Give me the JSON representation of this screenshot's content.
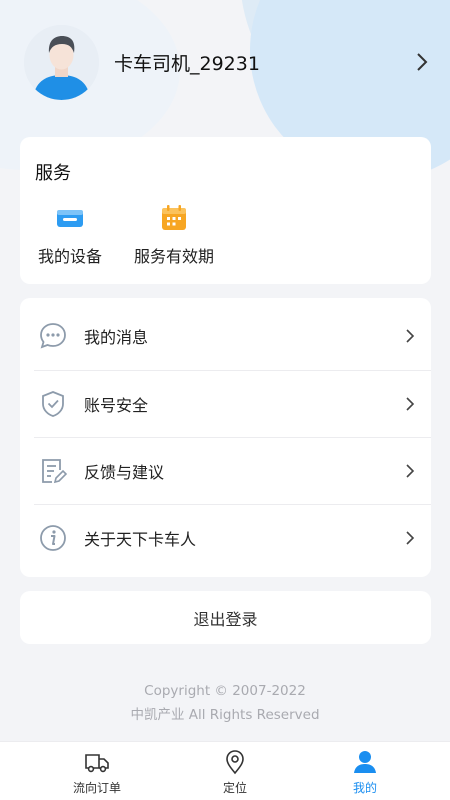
{
  "profile": {
    "name": "卡车司机_29231"
  },
  "services": {
    "title": "服务",
    "items": [
      {
        "label": "我的设备",
        "icon": "device-icon"
      },
      {
        "label": "服务有效期",
        "icon": "calendar-icon"
      }
    ]
  },
  "menu": {
    "items": [
      {
        "label": "我的消息",
        "icon": "message-icon"
      },
      {
        "label": "账号安全",
        "icon": "shield-check-icon"
      },
      {
        "label": "反馈与建议",
        "icon": "feedback-icon"
      },
      {
        "label": "关于天下卡车人",
        "icon": "info-icon"
      }
    ]
  },
  "logout": {
    "label": "退出登录"
  },
  "footer": {
    "copyright_line1": "Copyright © 2007-2022",
    "copyright_line2": "中凯产业 All Rights Reserved"
  },
  "tabbar": {
    "tabs": [
      {
        "label": "流向订单",
        "icon": "truck-icon",
        "active": false
      },
      {
        "label": "定位",
        "icon": "location-pin-icon",
        "active": false
      },
      {
        "label": "我的",
        "icon": "person-icon",
        "active": true
      }
    ]
  },
  "colors": {
    "accent": "#1a8ef0",
    "background": "#f3f4f7",
    "device_icon": "#2d9cf2",
    "calendar_icon": "#f7a623",
    "menu_icon": "#8d9bab"
  }
}
